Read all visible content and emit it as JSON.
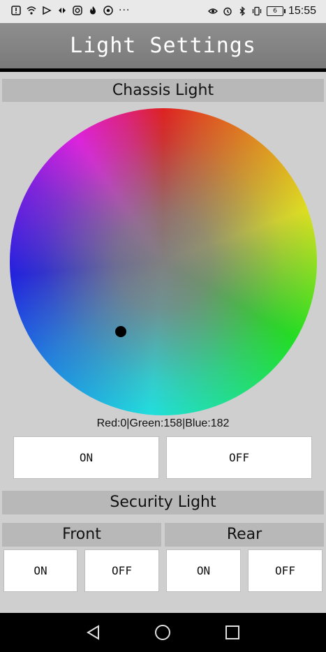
{
  "status_bar": {
    "time": "15:55",
    "battery_level": "6",
    "overflow": "···",
    "left_icons": [
      "alert-icon",
      "wifi-icon",
      "play-icon",
      "remote-icon",
      "instagram-icon",
      "flame-icon",
      "chrome-icon"
    ],
    "right_icons": [
      "eye-icon",
      "alarm-icon",
      "bluetooth-icon",
      "vibrate-icon",
      "battery-icon"
    ]
  },
  "app_bar": {
    "title": "Light Settings"
  },
  "chassis": {
    "title": "Chassis Light",
    "color_readout": "Red:0|Green:158|Blue:182",
    "selected_color": "#009eb6",
    "on_label": "ON",
    "off_label": "OFF"
  },
  "security": {
    "title": "Security Light",
    "front": {
      "title": "Front",
      "on_label": "ON",
      "off_label": "OFF"
    },
    "rear": {
      "title": "Rear",
      "on_label": "ON",
      "off_label": "OFF"
    }
  },
  "nav_bar": {
    "icons": [
      "back-icon",
      "home-icon",
      "recents-icon"
    ]
  }
}
